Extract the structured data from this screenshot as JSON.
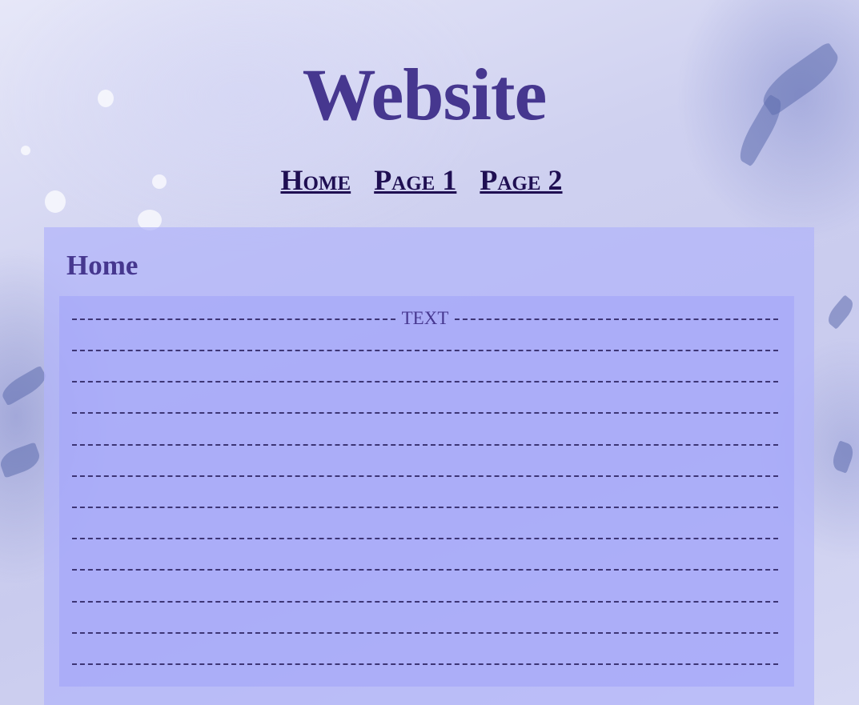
{
  "site": {
    "title": "Website"
  },
  "nav": {
    "items": [
      "Home",
      "Page 1",
      "Page 2"
    ]
  },
  "main": {
    "heading": "Home",
    "content_label": "TEXT",
    "line_count": 12
  },
  "colors": {
    "title": "#46378f",
    "nav_link": "#1f0f52",
    "panel": "#b2b4fa",
    "content_box": "#a0a3fa",
    "dash": "#3d3575"
  }
}
